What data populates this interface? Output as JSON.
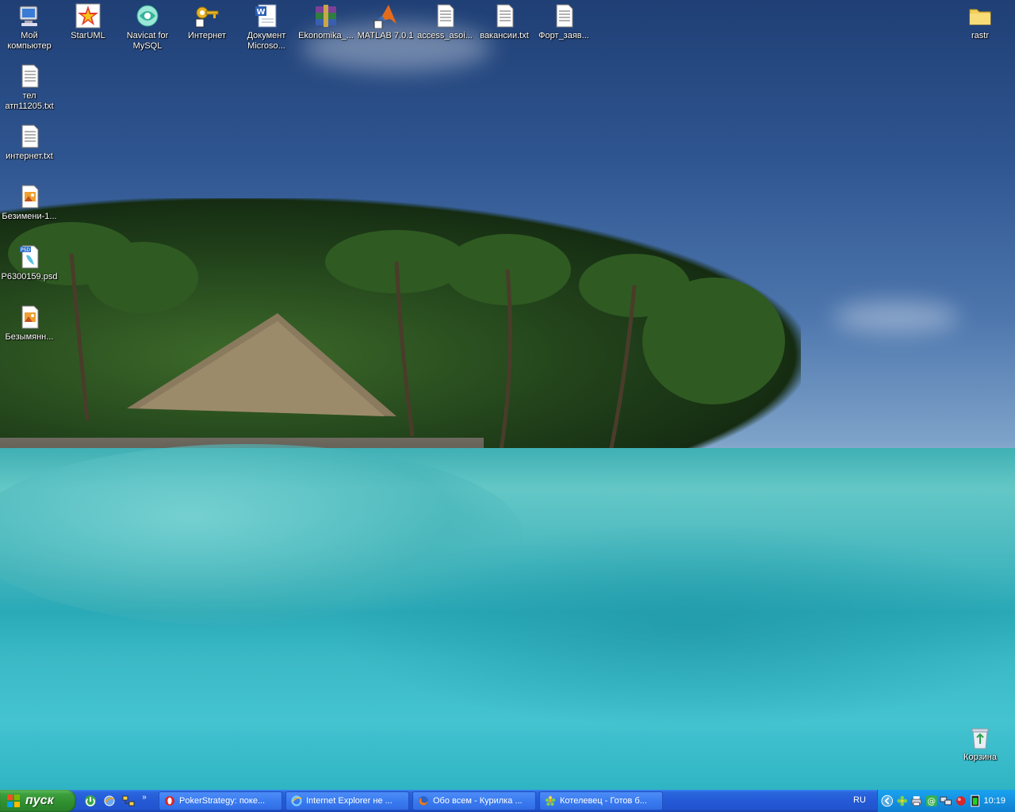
{
  "desktop": {
    "icons_top": [
      {
        "label": "Мой\nкомпьютер",
        "icon": "my-computer-icon"
      },
      {
        "label": "StarUML",
        "icon": "staruml-icon"
      },
      {
        "label": "Navicat for\nMySQL",
        "icon": "navicat-icon"
      },
      {
        "label": "Интернет",
        "icon": "internet-key-icon"
      },
      {
        "label": "Документ\nMicroso...",
        "icon": "word-document-icon"
      },
      {
        "label": "Ekonomika_...",
        "icon": "winrar-archive-icon"
      },
      {
        "label": "MATLAB 7.0.1",
        "icon": "matlab-icon"
      },
      {
        "label": "access_asoi...",
        "icon": "text-file-icon"
      },
      {
        "label": "вакансии.txt",
        "icon": "text-file-icon"
      },
      {
        "label": "Форт_заяв...",
        "icon": "text-file-icon"
      }
    ],
    "icons_left": [
      {
        "label": "тел\nатп11205.txt",
        "icon": "text-file-icon"
      },
      {
        "label": "интернет.txt",
        "icon": "text-file-icon"
      },
      {
        "label": "Безимени-1...",
        "icon": "image-file-icon"
      },
      {
        "label": "P6300159.psd",
        "icon": "psd-file-icon"
      },
      {
        "label": "Безымянн...",
        "icon": "image-file-icon"
      }
    ],
    "folder_rastr": {
      "label": "rastr",
      "icon": "folder-icon"
    },
    "recycle_bin": {
      "label": "Корзина",
      "icon": "recycle-bin-icon"
    }
  },
  "taskbar": {
    "start_label": "пуск",
    "quick_launch": [
      {
        "icon": "show-desktop-icon"
      },
      {
        "icon": "browser-icon"
      },
      {
        "icon": "network-icon"
      }
    ],
    "quick_more": "»",
    "tasks": [
      {
        "label": "PokerStrategy: поке...",
        "icon": "opera-icon"
      },
      {
        "label": "Internet Explorer не ...",
        "icon": "ie-icon"
      },
      {
        "label": "Обо всем - Курилка ...",
        "icon": "firefox-icon"
      },
      {
        "label": "Котелевец - Готов б...",
        "icon": "icq-icon"
      }
    ],
    "language": "RU",
    "tray_icons": [
      "collapse-arrow-icon",
      "icq-flower-icon",
      "printer-icon",
      "mail-agent-icon",
      "network-status-icon",
      "antivirus-icon",
      "battery-icon"
    ],
    "clock": "10:19"
  },
  "colors": {
    "taskbar_blue": "#2459d5",
    "start_green": "#3c9e3c",
    "tray_blue": "#1590e0"
  }
}
